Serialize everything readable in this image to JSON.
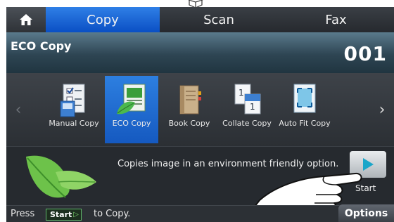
{
  "tabs": [
    {
      "label": "Copy",
      "active": true
    },
    {
      "label": "Scan",
      "active": false
    },
    {
      "label": "Fax",
      "active": false
    }
  ],
  "header": {
    "title": "ECO Copy",
    "count": "001"
  },
  "items": [
    {
      "label": "Manual Copy",
      "icon": "manual-copy-icon",
      "selected": false
    },
    {
      "label": "ECO Copy",
      "icon": "eco-copy-icon",
      "selected": true
    },
    {
      "label": "Book Copy",
      "icon": "book-copy-icon",
      "selected": false
    },
    {
      "label": "Collate Copy",
      "icon": "collate-copy-icon",
      "selected": false
    },
    {
      "label": "Auto Fit Copy",
      "icon": "auto-fit-copy-icon",
      "selected": false
    }
  ],
  "description": "Copies image in an environment friendly option.",
  "start_label": "Start",
  "bottom": {
    "press": "Press",
    "chip": "Start",
    "to_copy": "to Copy.",
    "options": "Options"
  },
  "colors": {
    "active_tab": "#1f66d8",
    "header": "#3b5868",
    "start_arrow": "#1aa6c9",
    "chip_border": "#5fb66a"
  }
}
